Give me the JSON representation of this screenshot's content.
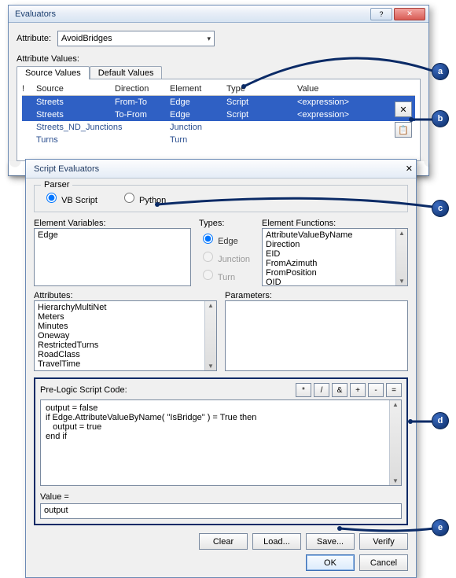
{
  "evaluators": {
    "title": "Evaluators",
    "attr_label": "Attribute:",
    "attr_value": "AvoidBridges",
    "values_label": "Attribute Values:",
    "tabs": {
      "source": "Source Values",
      "default": "Default Values"
    },
    "cols": {
      "bang": "!",
      "source": "Source",
      "direction": "Direction",
      "element": "Element",
      "type": "Type",
      "value": "Value"
    },
    "rows": [
      {
        "source": "Streets",
        "direction": "From-To",
        "element": "Edge",
        "type": "Script",
        "value": "<expression>",
        "sel": true
      },
      {
        "source": "Streets",
        "direction": "To-From",
        "element": "Edge",
        "type": "Script",
        "value": "<expression>",
        "sel": true
      },
      {
        "source": "Streets_ND_Junctions",
        "direction": "",
        "element": "Junction",
        "type": "",
        "value": "",
        "sel": false
      },
      {
        "source": "Turns",
        "direction": "",
        "element": "Turn",
        "type": "",
        "value": "",
        "sel": false
      }
    ],
    "delete_icon": "✕",
    "props_icon": "📋"
  },
  "script": {
    "title": "Script Evaluators",
    "parser_label": "Parser",
    "vb_label": "VB Script",
    "py_label": "Python",
    "elem_vars_label": "Element Variables:",
    "elem_vars": [
      "Edge"
    ],
    "types_label": "Types:",
    "type_edge": "Edge",
    "type_junction": "Junction",
    "type_turn": "Turn",
    "elem_funcs_label": "Element Functions:",
    "elem_funcs": [
      "AttributeValueByName",
      "Direction",
      "EID",
      "FromAzimuth",
      "FromPosition",
      "OID"
    ],
    "attributes_label": "Attributes:",
    "attributes": [
      "HierarchyMultiNet",
      "Meters",
      "Minutes",
      "Oneway",
      "RestrictedTurns",
      "RoadClass",
      "TravelTime"
    ],
    "parameters_label": "Parameters:",
    "prelogic_label": "Pre-Logic Script Code:",
    "ops": [
      "*",
      "/",
      "&",
      "+",
      "-",
      "="
    ],
    "code": "output = false\nif Edge.AttributeValueByName( \"IsBridge\" ) = True then\n   output = true\nend if",
    "value_label": "Value =",
    "value_text": "output",
    "btn_clear": "Clear",
    "btn_load": "Load...",
    "btn_save": "Save...",
    "btn_verify": "Verify",
    "btn_ok": "OK",
    "btn_cancel": "Cancel"
  },
  "callouts": {
    "a": "a",
    "b": "b",
    "c": "c",
    "d": "d",
    "e": "e"
  },
  "colors": {
    "highlight": "#2f60c4",
    "frame": "#0a2a66"
  }
}
